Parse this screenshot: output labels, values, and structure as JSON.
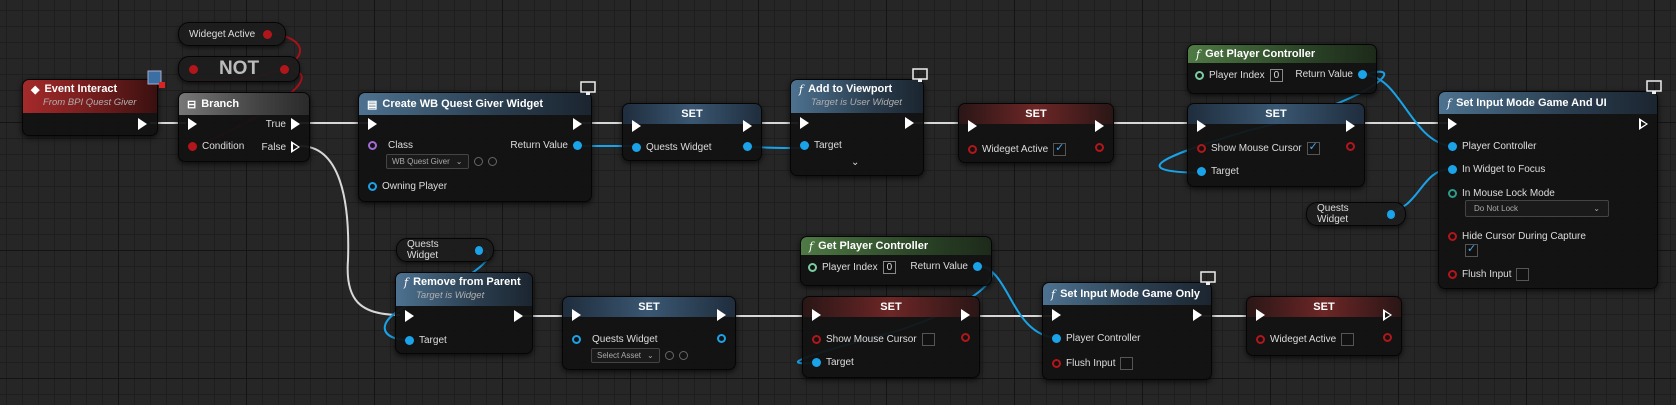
{
  "nodes": {
    "widget_active_get_top": {
      "label": "Wideget Active"
    },
    "not_node": {
      "label": "NOT"
    },
    "event_interact": {
      "title": "Event Interact",
      "subtitle": "From BPI Quest Giver"
    },
    "branch": {
      "title": "Branch",
      "condition": "Condition",
      "true_label": "True",
      "false_label": "False"
    },
    "create_widget": {
      "title": "Create WB Quest Giver Widget",
      "class_label": "Class",
      "class_value": "WB Quest Giver",
      "owning_player": "Owning Player",
      "return_value": "Return Value"
    },
    "set_quests_widget": {
      "title": "SET",
      "pin": "Quests Widget"
    },
    "add_to_viewport": {
      "title": "Add to Viewport",
      "subtitle": "Target is User Widget",
      "target": "Target"
    },
    "set_widget_active_true": {
      "title": "SET",
      "pin": "Wideget Active",
      "checked": true
    },
    "get_player_controller_top": {
      "title": "Get Player Controller",
      "player_index": "Player Index",
      "index_value": "0",
      "return_value": "Return Value"
    },
    "set_mouse_cursor_true": {
      "title": "SET",
      "pin": "Show Mouse Cursor",
      "target": "Target",
      "checked": true
    },
    "set_input_mode_game_ui": {
      "title": "Set Input Mode Game And UI",
      "player_controller": "Player Controller",
      "widget_focus": "In Widget to Focus",
      "mouse_lock": "In Mouse Lock Mode",
      "mouse_lock_value": "Do Not Lock",
      "hide_cursor": "Hide Cursor During Capture",
      "hide_cursor_checked": true,
      "flush_input": "Flush Input"
    },
    "quests_widget_get_right": {
      "label": "Quests Widget"
    },
    "quests_widget_get_bottom": {
      "label": "Quests Widget"
    },
    "remove_from_parent": {
      "title": "Remove from Parent",
      "subtitle": "Target is Widget",
      "target": "Target"
    },
    "set_quests_widget_null": {
      "title": "SET",
      "pin": "Quests Widget",
      "asset_value": "Select Asset"
    },
    "get_player_controller_bottom": {
      "title": "Get Player Controller",
      "player_index": "Player Index",
      "index_value": "0",
      "return_value": "Return Value"
    },
    "set_mouse_cursor_false": {
      "title": "SET",
      "pin": "Show Mouse Cursor",
      "target": "Target",
      "checked": false
    },
    "set_input_mode_game_only": {
      "title": "Set Input Mode Game Only",
      "player_controller": "Player Controller",
      "flush_input": "Flush Input"
    },
    "set_widget_active_false": {
      "title": "SET",
      "pin": "Wideget Active",
      "checked": false
    }
  },
  "colors": {
    "exec": "#ffffff",
    "object": "#1aa3e8",
    "bool": "#b3161a",
    "int": "#7ccca3",
    "class": "#a36bd6"
  }
}
